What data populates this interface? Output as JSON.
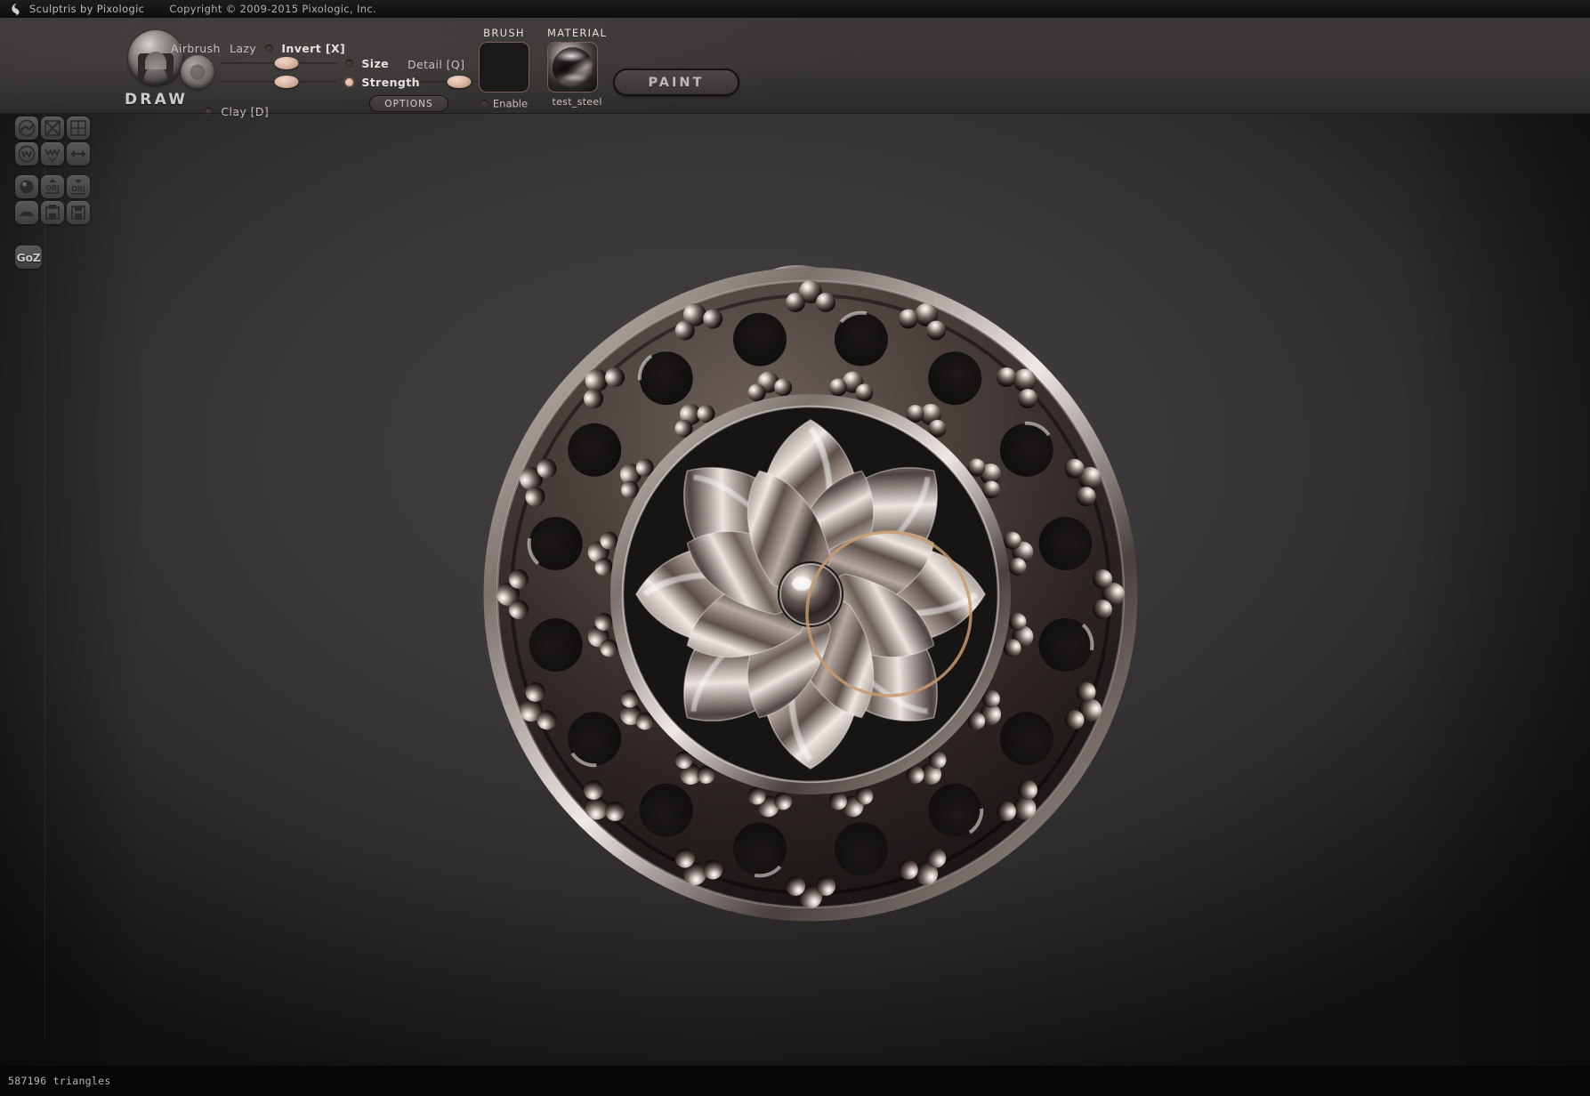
{
  "app": {
    "logo_icon": "sculptris-logo-icon",
    "title": "Sculptris by Pixologic",
    "copyright": "Copyright © 2009-2015 Pixologic, Inc."
  },
  "toolbar": {
    "active_tool_label": "DRAW",
    "brush_sphere_icon": "draw-brush-preview-sphere",
    "falloff_sphere_icon": "brush-falloff-preview-sphere",
    "modes": [
      {
        "id": "airbrush",
        "label": "Airbrush",
        "has_radio": false,
        "on": false
      },
      {
        "id": "lazy",
        "label": "Lazy",
        "has_radio": false,
        "on": false
      },
      {
        "id": "invert",
        "label": "Invert [X]",
        "has_radio": true,
        "on": false
      },
      {
        "id": "clay",
        "label": "Clay [D]",
        "has_radio": true,
        "on": false
      }
    ],
    "sliders": [
      {
        "id": "size",
        "label": "Size",
        "value_pct": 57,
        "radio_on": false
      },
      {
        "id": "strength",
        "label": "Strength",
        "value_pct": 57,
        "radio_on": true
      },
      {
        "id": "detail",
        "label": "Detail [Q]",
        "value_pct": 48,
        "radio_on": false
      }
    ],
    "options_label": "OPTIONS"
  },
  "brush_panel": {
    "title": "BRUSH",
    "swatch_icon": "brush-alpha-swatch",
    "enable_label": "Enable",
    "enable_on": false
  },
  "material_panel": {
    "title": "MATERIAL",
    "swatch_icon": "material-sphere-swatch",
    "name": "test_steel"
  },
  "paint_button": {
    "label": "PAINT"
  },
  "left_toolbar": {
    "rows": [
      [
        {
          "id": "crease",
          "icon": "crease-tool-icon",
          "active": false
        },
        {
          "id": "rotate",
          "icon": "rotate-tool-icon",
          "active": false
        },
        {
          "id": "crop",
          "icon": "crop-tool-icon",
          "active": false
        }
      ],
      [
        {
          "id": "draw",
          "icon": "draw-tool-icon",
          "active": true
        },
        {
          "id": "flatten",
          "icon": "flatten-tool-icon",
          "active": false
        },
        {
          "id": "move",
          "icon": "move-tool-icon",
          "active": false
        }
      ],
      [
        {
          "id": "pinch",
          "icon": "pinch-tool-icon",
          "active": false
        },
        {
          "id": "smooth",
          "icon": "smooth-tool-icon",
          "active": false
        },
        {
          "id": "inflate",
          "icon": "inflate-tool-icon",
          "active": false
        }
      ],
      [
        {
          "id": "grab",
          "icon": "grab-curve-icon",
          "active": false
        },
        {
          "id": "mask-off",
          "icon": "mask-disabled-icon",
          "active": false
        },
        {
          "id": "grid",
          "icon": "grid-tool-icon",
          "active": false
        }
      ],
      [
        {
          "id": "wireframe",
          "icon": "wireframe-mask-icon",
          "active": false
        },
        {
          "id": "reduce",
          "icon": "reduce-brush-icon",
          "active": false
        },
        {
          "id": "symmetry",
          "icon": "symmetry-arrows-icon",
          "active": false
        }
      ],
      [
        {
          "id": "sphere-new",
          "icon": "new-sphere-icon",
          "active": false
        },
        {
          "id": "obj-import",
          "icon": "obj-import-icon",
          "active": false,
          "text": "OBJ"
        },
        {
          "id": "obj-export",
          "icon": "obj-export-icon",
          "active": false,
          "text": "OBJ"
        }
      ],
      [
        {
          "id": "plane",
          "icon": "plane-tool-icon",
          "active": false
        },
        {
          "id": "open-file",
          "icon": "open-file-icon",
          "active": false
        },
        {
          "id": "save-file",
          "icon": "save-file-icon",
          "active": false
        }
      ]
    ],
    "goz_label": "GoZ"
  },
  "viewport": {
    "model_name": "flower-pendant-model",
    "cursor_icon": "brush-cursor-ring",
    "cursor_color": "#c89a6e"
  },
  "statusbar": {
    "triangles_text": "587196 triangles"
  },
  "colors": {
    "panel_bg": "#393635",
    "canvas_bg": "#3a3838",
    "accent_orange": "#c46c36",
    "slider_knob": "#ddbba9",
    "text_primary": "#c4c0bd",
    "swatch_border": "#7b5f57"
  }
}
